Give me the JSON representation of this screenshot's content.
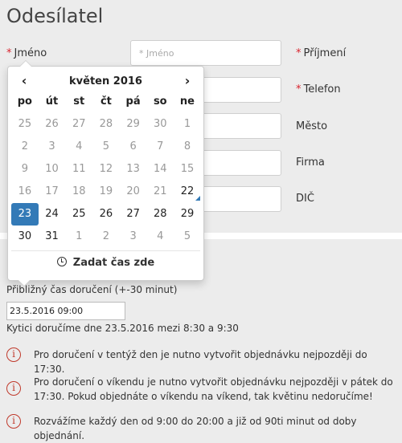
{
  "section_title": "Odesílatel",
  "fields": {
    "jmeno_label": "Jméno",
    "jmeno_placeholder": "* Jméno",
    "prijmeni_label": "Příjmení",
    "telefon_label": "Telefon",
    "mesto_label": "Město",
    "firma_label": "Firma",
    "dic_label": "DIČ"
  },
  "calendar": {
    "prev_icon": "‹",
    "next_icon": "›",
    "month_label": "květen 2016",
    "weekdays": [
      "po",
      "út",
      "st",
      "čt",
      "pá",
      "so",
      "ne"
    ],
    "weeks": [
      [
        "25",
        "26",
        "27",
        "28",
        "29",
        "30",
        "1"
      ],
      [
        "2",
        "3",
        "4",
        "5",
        "6",
        "7",
        "8"
      ],
      [
        "9",
        "10",
        "11",
        "12",
        "13",
        "14",
        "15"
      ],
      [
        "16",
        "17",
        "18",
        "19",
        "20",
        "21",
        "22"
      ],
      [
        "23",
        "24",
        "25",
        "26",
        "27",
        "28",
        "29"
      ],
      [
        "30",
        "31",
        "1",
        "2",
        "3",
        "4",
        "5"
      ]
    ],
    "time_button": "Zadat čas zde",
    "selected_color": "#337ab7"
  },
  "delivery": {
    "time_label": "Přibližný čas doručení (+-30 minut)",
    "datetime_value": "23.5.2016 09:00",
    "note": "Kytici doručíme dne 23.5.2016 mezi 8:30 a 9:30"
  },
  "info": [
    {
      "icon": "info-icon",
      "text": "Pro doručení v tentýž den je nutno vytvořit objednávku nejpozději do 17:30."
    },
    {
      "icon": "info-icon",
      "text": "Pro doručení o víkendu je nutno vytvořit objednávku nejpozději v pátek do 17:30. Pokud objednáte o víkendu na víkend, tak květinu nedoručíme!"
    },
    {
      "icon": "info-icon",
      "text": "Rozvážíme každý den od 9:00 do 20:00 a již od 90ti minut od doby objednání."
    }
  ],
  "colors": {
    "required": "#d9232d",
    "info": "#c0392b"
  }
}
